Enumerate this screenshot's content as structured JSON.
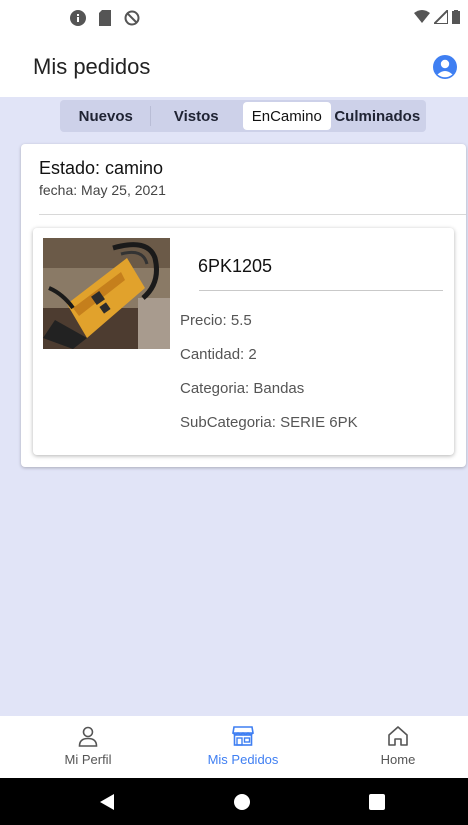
{
  "header": {
    "title": "Mis pedidos",
    "account_icon": "account-circle-icon"
  },
  "tabs": [
    {
      "label": "Nuevos",
      "active": false
    },
    {
      "label": "Vistos",
      "active": false
    },
    {
      "label": "EnCamino",
      "active": true
    },
    {
      "label": "Culminados",
      "active": false
    }
  ],
  "order": {
    "status": "Estado: camino",
    "date": "fecha: May 25, 2021",
    "item": {
      "name": "6PK1205",
      "price": "Precio: 5.5",
      "quantity": "Cantidad: 2",
      "category": "Categoria: Bandas",
      "subcategory": "SubCategoria: SERIE 6PK"
    }
  },
  "bottom_nav": [
    {
      "label": "Mi Perfil",
      "icon": "person-icon",
      "active": false
    },
    {
      "label": "Mis Pedidos",
      "icon": "store-icon",
      "active": true
    },
    {
      "label": "Home",
      "icon": "home-icon",
      "active": false
    }
  ],
  "colors": {
    "accent": "#3f7ff2",
    "content_bg": "#e1e4f7",
    "tab_bg": "#cdd1e9",
    "nav_inactive": "#555555"
  }
}
